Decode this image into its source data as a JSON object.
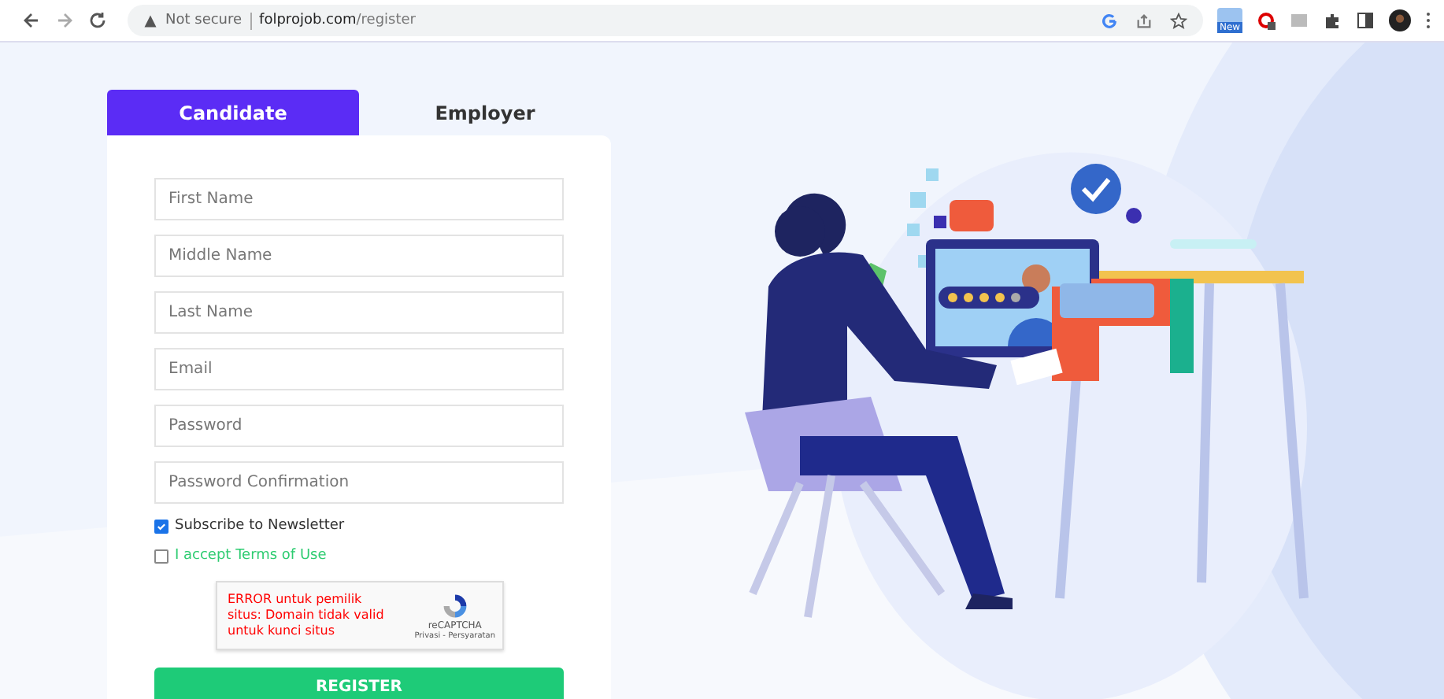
{
  "browser": {
    "security": "Not secure",
    "domain": "folprojob.com",
    "path": "/register",
    "extension_badge": "New"
  },
  "tabs": [
    {
      "label": "Candidate",
      "selected": true
    },
    {
      "label": "Employer",
      "selected": false
    }
  ],
  "fields": [
    {
      "placeholder": "First Name"
    },
    {
      "placeholder": "Middle Name"
    },
    {
      "placeholder": "Last Name"
    },
    {
      "placeholder": "Email"
    },
    {
      "placeholder": "Password"
    },
    {
      "placeholder": "Password Confirmation"
    }
  ],
  "checkboxes": [
    {
      "label": "Subscribe to Newsletter",
      "checked": true,
      "kind": "plain"
    },
    {
      "label": "I accept Terms of Use",
      "checked": false,
      "kind": "link"
    }
  ],
  "captcha": {
    "error": "ERROR untuk pemilik situs: Domain tidak valid untuk kunci situs",
    "brand": "reCAPTCHA",
    "links": "Privasi - Persyaratan"
  },
  "submit": "REGISTER"
}
